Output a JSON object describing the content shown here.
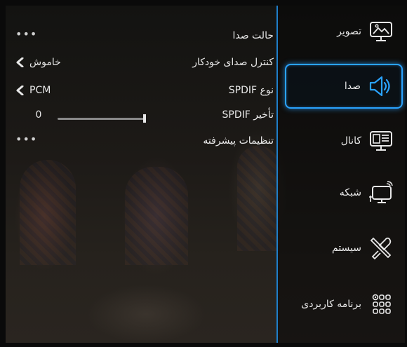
{
  "settings": {
    "items": [
      {
        "label": "حالت صدا",
        "value": "",
        "control": "more"
      },
      {
        "label": "کنترل صدای خودکار",
        "value": "خاموش",
        "control": "select"
      },
      {
        "label": "نوع SPDIF",
        "value": "PCM",
        "control": "select"
      },
      {
        "label": "تأخیر SPDIF",
        "value": "0",
        "control": "slider",
        "level": 0
      },
      {
        "label": "تنظیمات پیشرفته",
        "value": "",
        "control": "more"
      }
    ]
  },
  "sidebar": {
    "items": [
      {
        "label": "تصویر",
        "icon": "picture-icon"
      },
      {
        "label": "صدا",
        "icon": "sound-icon",
        "selected": true
      },
      {
        "label": "کانال",
        "icon": "channel-icon"
      },
      {
        "label": "شبکه",
        "icon": "network-icon"
      },
      {
        "label": "سیستم",
        "icon": "system-icon"
      },
      {
        "label": "برنامه کاربردی",
        "icon": "apps-icon"
      }
    ]
  },
  "colors": {
    "accent": "#2aa3ff",
    "divider": "#1f7fc9"
  }
}
